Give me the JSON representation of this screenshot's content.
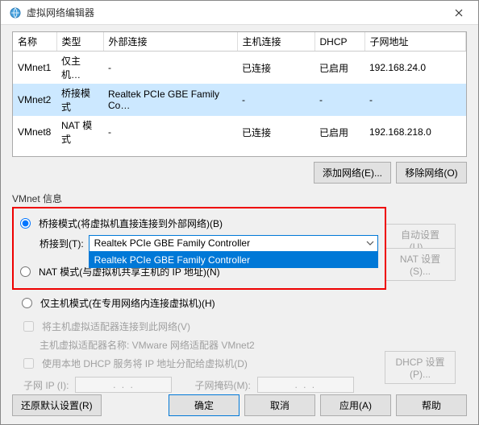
{
  "title": "虚拟网络编辑器",
  "table": {
    "headers": {
      "name": "名称",
      "type": "类型",
      "ext": "外部连接",
      "host": "主机连接",
      "dhcp": "DHCP",
      "subnet": "子网地址"
    },
    "rows": [
      {
        "name": "VMnet1",
        "type": "仅主机…",
        "ext": "-",
        "host": "已连接",
        "dhcp": "已启用",
        "subnet": "192.168.24.0"
      },
      {
        "name": "VMnet2",
        "type": "桥接模式",
        "ext": "Realtek PCIe GBE Family Co…",
        "host": "-",
        "dhcp": "-",
        "subnet": "-"
      },
      {
        "name": "VMnet8",
        "type": "NAT 模式",
        "ext": "-",
        "host": "已连接",
        "dhcp": "已启用",
        "subnet": "192.168.218.0"
      }
    ]
  },
  "buttons": {
    "add_net": "添加网络(E)...",
    "remove_net": "移除网络(O)",
    "auto_set": "自动设置(U)...",
    "nat_set": "NAT 设置(S)...",
    "dhcp_set": "DHCP 设置(P)...",
    "restore": "还原默认设置(R)",
    "ok": "确定",
    "cancel": "取消",
    "apply": "应用(A)",
    "help": "帮助"
  },
  "group": {
    "title": "VMnet 信息"
  },
  "radios": {
    "bridged": "桥接模式(将虚拟机直接连接到外部网络)(B)",
    "bridged_to": "桥接到(T):",
    "nat": "NAT 模式(与虚拟机共享主机的 IP 地址)(N)",
    "hostonly": "仅主机模式(在专用网络内连接虚拟机)(H)"
  },
  "combo": {
    "selected": "Realtek PCIe GBE Family Controller",
    "option0": "Realtek PCIe GBE Family Controller"
  },
  "checks": {
    "connect_host": "将主机虚拟适配器连接到此网络(V)",
    "adapter_label": "主机虚拟适配器名称: VMware 网络适配器 VMnet2",
    "use_dhcp": "使用本地 DHCP 服务将 IP 地址分配给虚拟机(D)"
  },
  "ip": {
    "subnet_label": "子网 IP (I):",
    "subnet_dots": ".       .       .",
    "mask_label": "子网掩码(M):",
    "mask_dots": ".       .       ."
  }
}
